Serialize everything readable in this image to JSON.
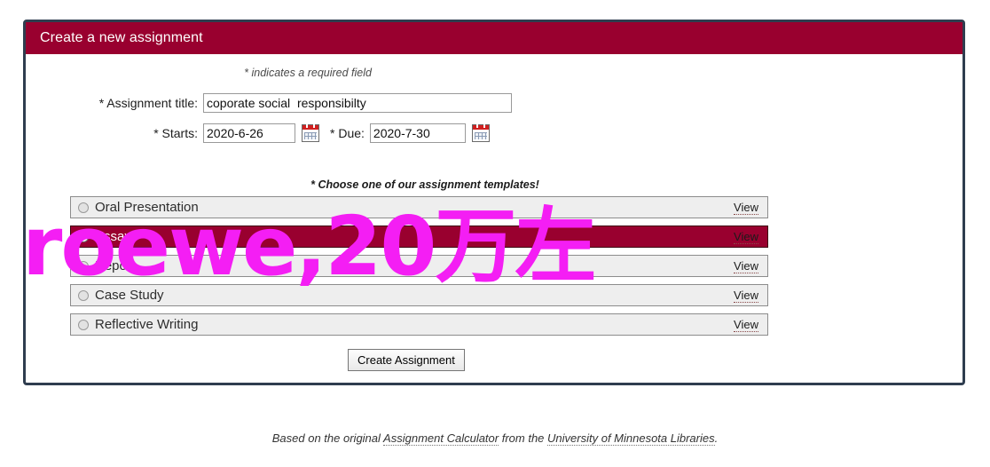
{
  "panel": {
    "header_title": "Create a new assignment",
    "required_note": "* indicates a required field",
    "choose_note": "* Choose one of our assignment templates!"
  },
  "form": {
    "title_label": "* Assignment title:",
    "title_value": "coporate social  responsibilty",
    "title_placeholder": "",
    "starts_label": "* Starts:",
    "starts_value": "2020-6-26",
    "due_label": "* Due:",
    "due_value": "2020-7-30",
    "start_calendar_icon": "calendar-icon",
    "due_calendar_icon": "calendar-icon"
  },
  "templates": {
    "view_label": "View",
    "items": [
      {
        "label": "Oral Presentation",
        "selected": false
      },
      {
        "label": "Essay",
        "selected": true
      },
      {
        "label": "Report",
        "selected": false
      },
      {
        "label": "Case Study",
        "selected": false
      },
      {
        "label": "Reflective Writing",
        "selected": false
      }
    ]
  },
  "actions": {
    "create_label": "Create Assignment"
  },
  "footer": {
    "prefix": "Based on the original ",
    "calculator_link": "Assignment Calculator",
    "middle": " from the ",
    "library_link": "University of Minnesota Libraries",
    "suffix": "."
  },
  "watermark": {
    "text": "roewe,20万左",
    "color": "#f41ef4"
  },
  "colors": {
    "brand": "#99002f",
    "panel_border": "#2f3d4f",
    "row_background": "#eeeeee"
  }
}
